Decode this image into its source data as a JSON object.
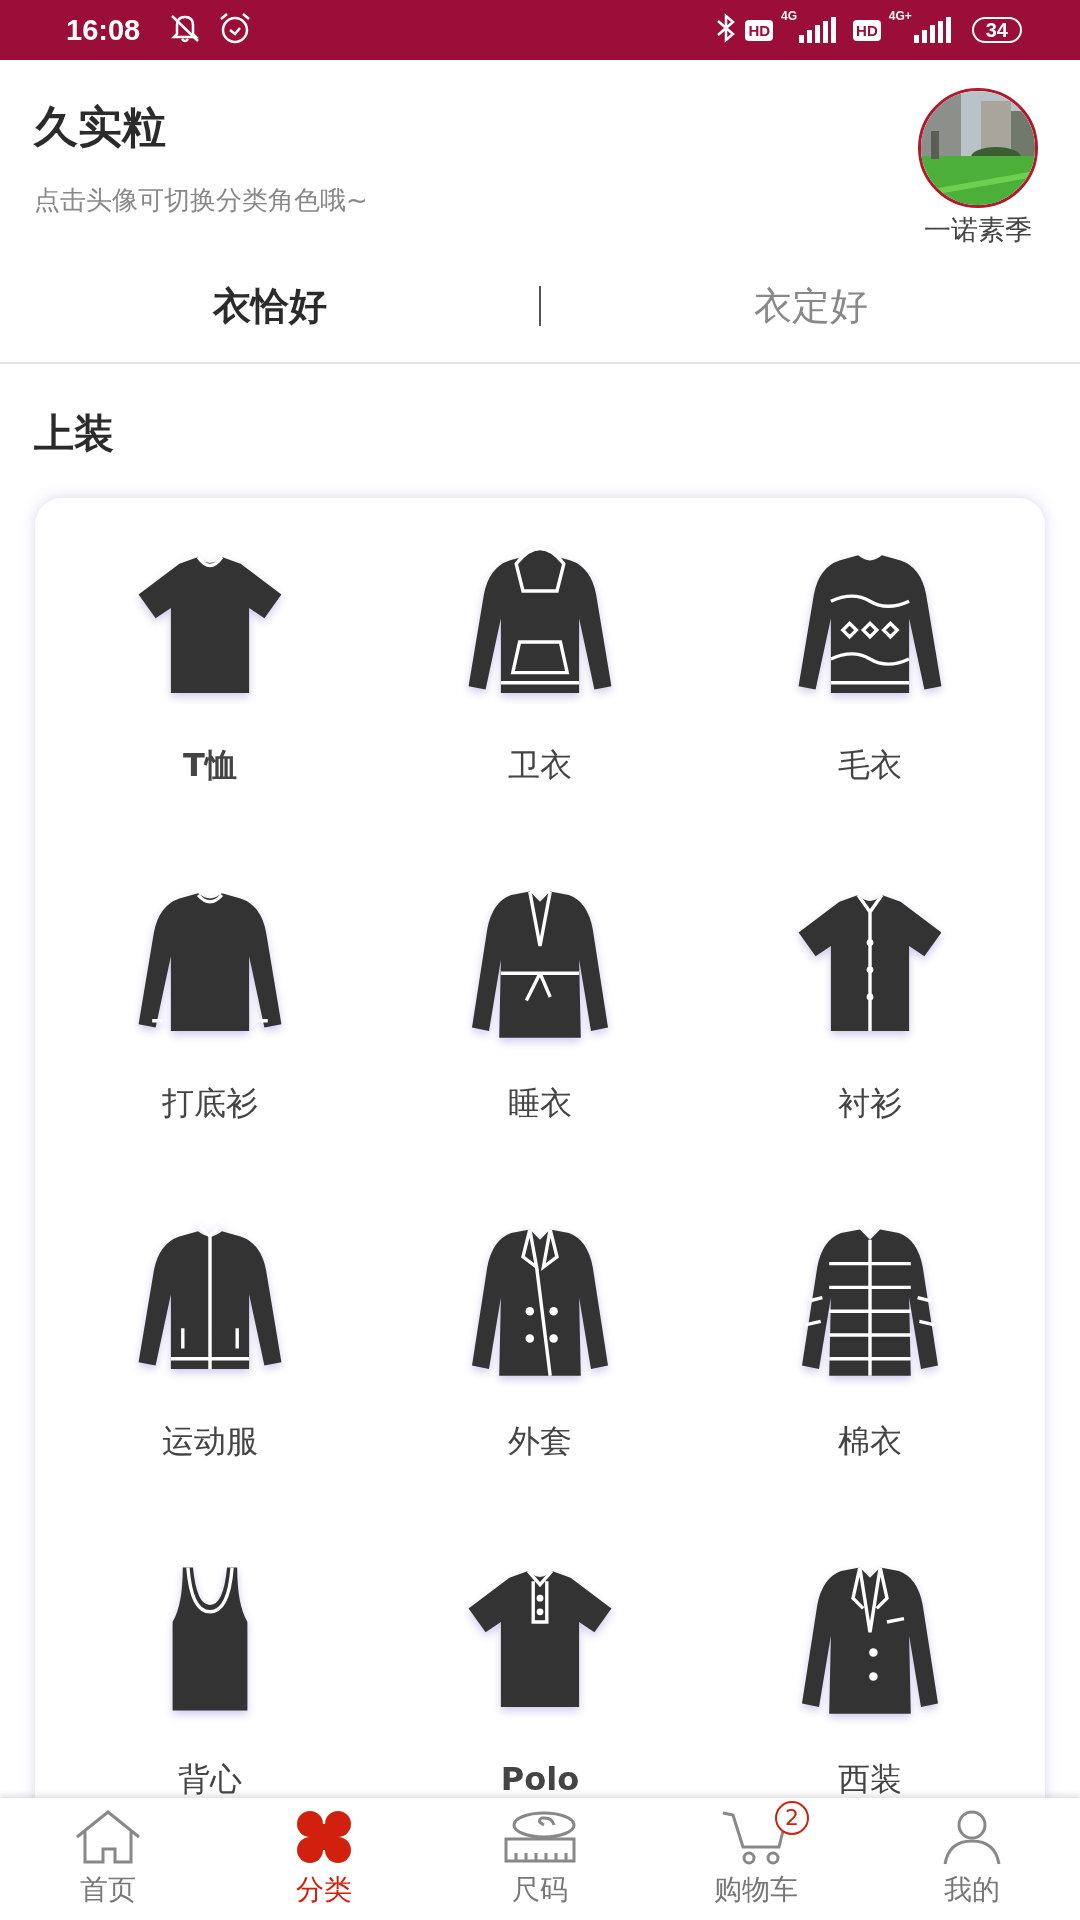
{
  "status_bar": {
    "time": "16:08",
    "hd_badges": [
      "HD",
      "HD"
    ],
    "networks": [
      "4G",
      "4G+"
    ],
    "battery": "34"
  },
  "header": {
    "title": "久实粒",
    "hint": "点击头像可切换分类角色哦~",
    "avatar": {
      "kind": "picture",
      "name": "一诺素季"
    }
  },
  "tabs": [
    {
      "label": "衣恰好",
      "selected": true
    },
    {
      "label": "衣定好",
      "selected": false
    }
  ],
  "section": {
    "title": "上装",
    "items": [
      {
        "label": "T恤"
      },
      {
        "label": "卫衣"
      },
      {
        "label": "毛衣"
      },
      {
        "label": "打底衫"
      },
      {
        "label": "睡衣"
      },
      {
        "label": "衬衫"
      },
      {
        "label": "运动服"
      },
      {
        "label": "外套"
      },
      {
        "label": "棉衣"
      },
      {
        "label": "背心"
      },
      {
        "label": "Polo"
      },
      {
        "label": "西装"
      }
    ]
  },
  "bottom_nav": [
    {
      "label": "首页",
      "selected": false
    },
    {
      "label": "分类",
      "selected": true
    },
    {
      "label": "尺码",
      "selected": false
    },
    {
      "label": "购物车",
      "selected": false,
      "badge": "2"
    },
    {
      "label": "我的",
      "selected": false
    }
  ]
}
